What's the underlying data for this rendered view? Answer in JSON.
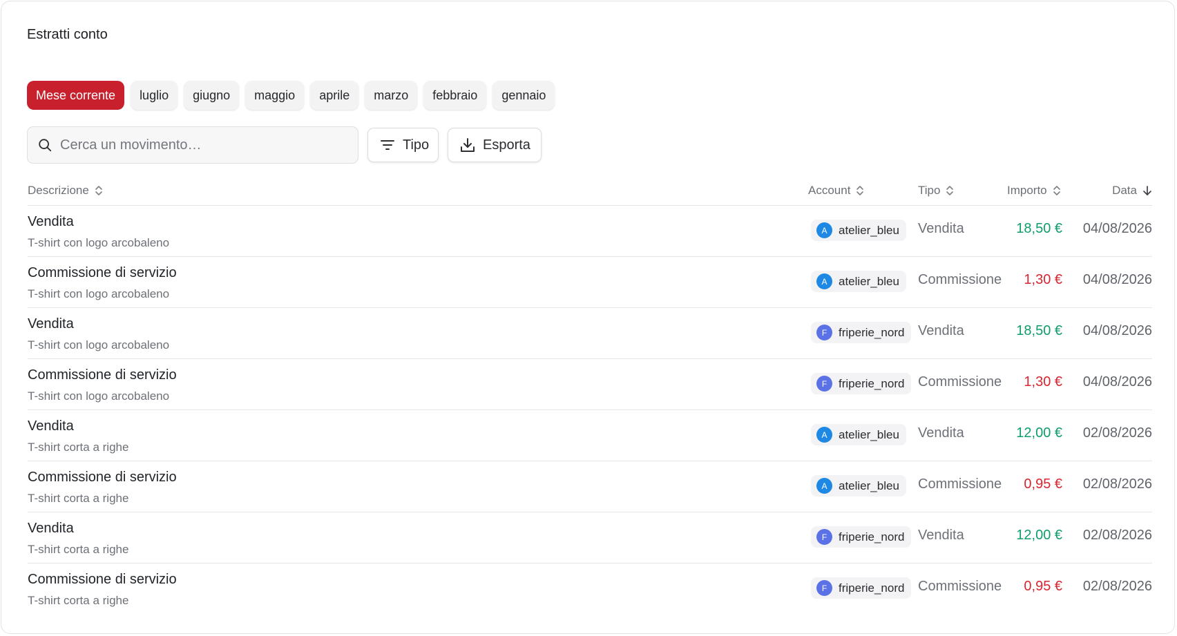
{
  "colors": {
    "accent": "#c8202c",
    "positive": "#0f9d6a",
    "negative": "#d7262f",
    "avatar_a": "#1e88e5",
    "avatar_f": "#5b72e6"
  },
  "header": {
    "title": "Estratti conto"
  },
  "filters": {
    "months": [
      "Mese corrente",
      "luglio",
      "giugno",
      "maggio",
      "aprile",
      "marzo",
      "febbraio",
      "gennaio"
    ],
    "selected": "Mese corrente"
  },
  "toolbar": {
    "search_placeholder": "Cerca un movimento…",
    "search_value": "",
    "type_label": "Tipo",
    "export_label": "Esporta"
  },
  "table": {
    "columns": {
      "description": "Descrizione",
      "account": "Account",
      "type": "Tipo",
      "amount": "Importo",
      "date": "Data"
    },
    "sort": {
      "column": "date",
      "direction": "desc"
    },
    "rows": [
      {
        "title": "Vendita",
        "subtitle": "T-shirt con logo arcobaleno",
        "account": "atelier_bleu",
        "avatar": "A",
        "type": "Vendita",
        "amount": "18,50 €",
        "sign": "positive",
        "date": "04/08/2026"
      },
      {
        "title": "Commissione di servizio",
        "subtitle": "T-shirt con logo arcobaleno",
        "account": "atelier_bleu",
        "avatar": "A",
        "type": "Commissione",
        "amount": "1,30 €",
        "sign": "negative",
        "date": "04/08/2026"
      },
      {
        "title": "Vendita",
        "subtitle": "T-shirt con logo arcobaleno",
        "account": "friperie_nord",
        "avatar": "F",
        "type": "Vendita",
        "amount": "18,50 €",
        "sign": "positive",
        "date": "04/08/2026"
      },
      {
        "title": "Commissione di servizio",
        "subtitle": "T-shirt con logo arcobaleno",
        "account": "friperie_nord",
        "avatar": "F",
        "type": "Commissione",
        "amount": "1,30 €",
        "sign": "negative",
        "date": "04/08/2026"
      },
      {
        "title": "Vendita",
        "subtitle": "T-shirt corta a righe",
        "account": "atelier_bleu",
        "avatar": "A",
        "type": "Vendita",
        "amount": "12,00 €",
        "sign": "positive",
        "date": "02/08/2026"
      },
      {
        "title": "Commissione di servizio",
        "subtitle": "T-shirt corta a righe",
        "account": "atelier_bleu",
        "avatar": "A",
        "type": "Commissione",
        "amount": "0,95 €",
        "sign": "negative",
        "date": "02/08/2026"
      },
      {
        "title": "Vendita",
        "subtitle": "T-shirt corta a righe",
        "account": "friperie_nord",
        "avatar": "F",
        "type": "Vendita",
        "amount": "12,00 €",
        "sign": "positive",
        "date": "02/08/2026"
      },
      {
        "title": "Commissione di servizio",
        "subtitle": "T-shirt corta a righe",
        "account": "friperie_nord",
        "avatar": "F",
        "type": "Commissione",
        "amount": "0,95 €",
        "sign": "negative",
        "date": "02/08/2026"
      }
    ]
  }
}
